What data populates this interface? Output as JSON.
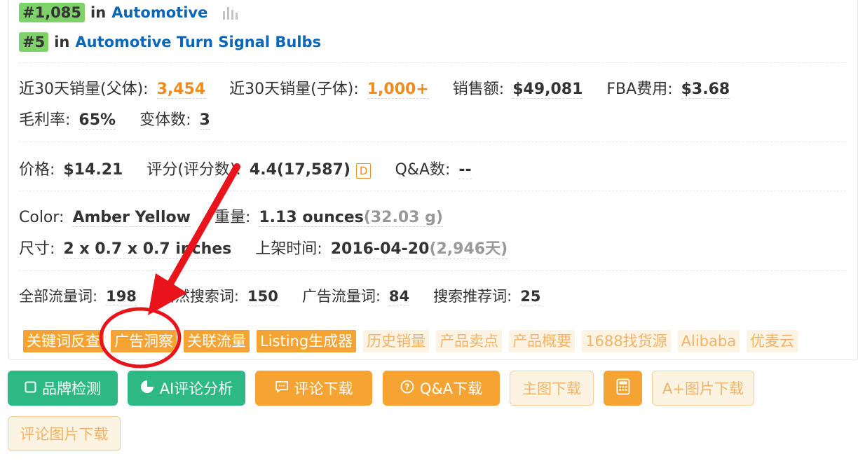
{
  "rankings": [
    {
      "rank": "#1,085",
      "in": "in",
      "category": "Automotive"
    },
    {
      "rank": "#5",
      "in": "in",
      "category": "Automotive Turn Signal Bulbs"
    }
  ],
  "sales": {
    "parent_label": "近30天销量(父体):",
    "parent_value": "3,454",
    "child_label": "近30天销量(子体):",
    "child_value": "1,000+",
    "revenue_label": "销售额:",
    "revenue_value": "$49,081",
    "fba_label": "FBA费用:",
    "fba_value": "$3.68",
    "margin_label": "毛利率:",
    "margin_value": "65%",
    "variants_label": "变体数:",
    "variants_value": "3"
  },
  "pricing": {
    "price_label": "价格:",
    "price_value": "$14.21",
    "rating_label": "评分(评分数):",
    "rating_value": "4.4(17,587)",
    "rating_badge": "D",
    "qa_label": "Q&A数:",
    "qa_value": "--"
  },
  "attributes": {
    "color_label": "Color:",
    "color_value": "Amber Yellow",
    "weight_label": "重量:",
    "weight_value": "1.13 ounces",
    "weight_metric": "(32.03 g)",
    "size_label": "尺寸:",
    "size_value": "2 x 0.7 x 0.7 inches",
    "listed_label": "上架时间:",
    "listed_value": "2016-04-20",
    "listed_days": "(2,946天)"
  },
  "traffic": {
    "all_label": "全部流量词:",
    "all_value": "198",
    "organic_label": "自然搜索词:",
    "organic_value": "150",
    "ad_label": "广告流量词:",
    "ad_value": "84",
    "suggest_label": "搜索推荐词:",
    "suggest_value": "25"
  },
  "tags": [
    {
      "label": "关键词反查",
      "style": "solid"
    },
    {
      "label": "广告洞察",
      "style": "solid"
    },
    {
      "label": "关联流量",
      "style": "solid"
    },
    {
      "label": "Listing生成器",
      "style": "solid"
    },
    {
      "label": "历史销量",
      "style": "light"
    },
    {
      "label": "产品卖点",
      "style": "light"
    },
    {
      "label": "产品概要",
      "style": "light"
    },
    {
      "label": "1688找货源",
      "style": "light"
    },
    {
      "label": "Alibaba",
      "style": "light"
    },
    {
      "label": "优麦云",
      "style": "light"
    }
  ],
  "actions": {
    "brand_check": "品牌检测",
    "ai_review": "AI评论分析",
    "review_download": "评论下载",
    "qa_download": "Q&A下载",
    "main_image_download": "主图下载",
    "aplus_download": "A+图片下载",
    "review_image_download": "评论图片下载"
  },
  "icons": {
    "bars": "bar-chart-icon",
    "square": "square-icon",
    "pie": "pie-chart-icon",
    "chat": "chat-icon",
    "question": "question-circle-icon",
    "calculator": "calculator-icon"
  },
  "colors": {
    "accent_orange": "#f5a332",
    "accent_green": "#2db884",
    "link_blue": "#0a66b8",
    "badge_green": "#7fd16a",
    "annotation_red": "#e8131b"
  }
}
